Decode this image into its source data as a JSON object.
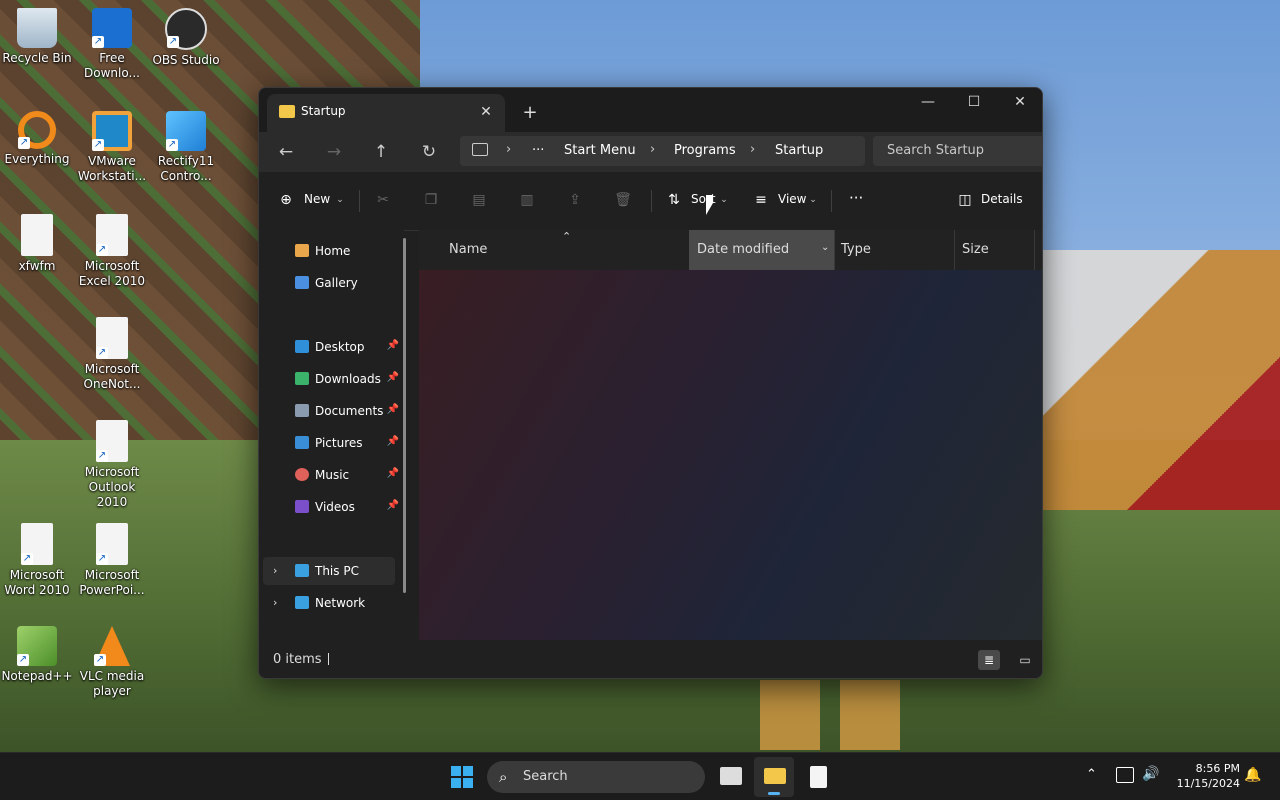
{
  "desktop": {
    "icons": [
      {
        "label": "Recycle Bin",
        "icon": "recycle-bin-icon"
      },
      {
        "label": "Free Downlo...",
        "icon": "free-download-manager-icon"
      },
      {
        "label": "OBS Studio",
        "icon": "obs-studio-icon"
      },
      {
        "label": "Everything",
        "icon": "everything-search-icon"
      },
      {
        "label": "VMware Workstati...",
        "icon": "vmware-icon"
      },
      {
        "label": "Rectify11 Contro...",
        "icon": "rectify11-icon"
      },
      {
        "label": "xfwfm",
        "icon": "blank-file-icon"
      },
      {
        "label": "Microsoft Excel 2010",
        "icon": "excel-file-icon"
      },
      {
        "label": "Microsoft OneNot...",
        "icon": "onenote-file-icon"
      },
      {
        "label": "Microsoft Outlook 2010",
        "icon": "outlook-file-icon"
      },
      {
        "label": "Microsoft Word 2010",
        "icon": "word-file-icon"
      },
      {
        "label": "Microsoft PowerPoi...",
        "icon": "powerpoint-file-icon"
      },
      {
        "label": "Notepad++",
        "icon": "notepadpp-icon"
      },
      {
        "label": "VLC media player",
        "icon": "vlc-icon"
      }
    ]
  },
  "explorer": {
    "tab_title": "Startup",
    "new_tab": "+",
    "window_buttons": {
      "minimize": "—",
      "maximize": "☐",
      "close": "✕"
    },
    "breadcrumb": [
      "Start Menu",
      "Programs",
      "Startup"
    ],
    "more_crumbs": "···",
    "search_placeholder": "Search Startup",
    "toolbar": {
      "new_label": "New",
      "sort_label": "Sort",
      "view_label": "View",
      "more": "···",
      "details_label": "Details"
    },
    "sidebar": {
      "home": "Home",
      "gallery": "Gallery",
      "quick": [
        {
          "label": "Desktop",
          "color": "#2f8fd8"
        },
        {
          "label": "Downloads",
          "color": "#3bb36a"
        },
        {
          "label": "Documents",
          "color": "#8a9bb0"
        },
        {
          "label": "Pictures",
          "color": "#3a8ed6"
        },
        {
          "label": "Music",
          "color": "#e0605a"
        },
        {
          "label": "Videos",
          "color": "#7a4fc9"
        }
      ],
      "this_pc": "This PC",
      "network": "Network"
    },
    "columns": {
      "name": "Name",
      "date": "Date modified",
      "type": "Type",
      "size": "Size"
    },
    "status": "0 items"
  },
  "taskbar": {
    "search_label": "Search",
    "time": "8:56 PM",
    "date": "11/15/2024"
  }
}
